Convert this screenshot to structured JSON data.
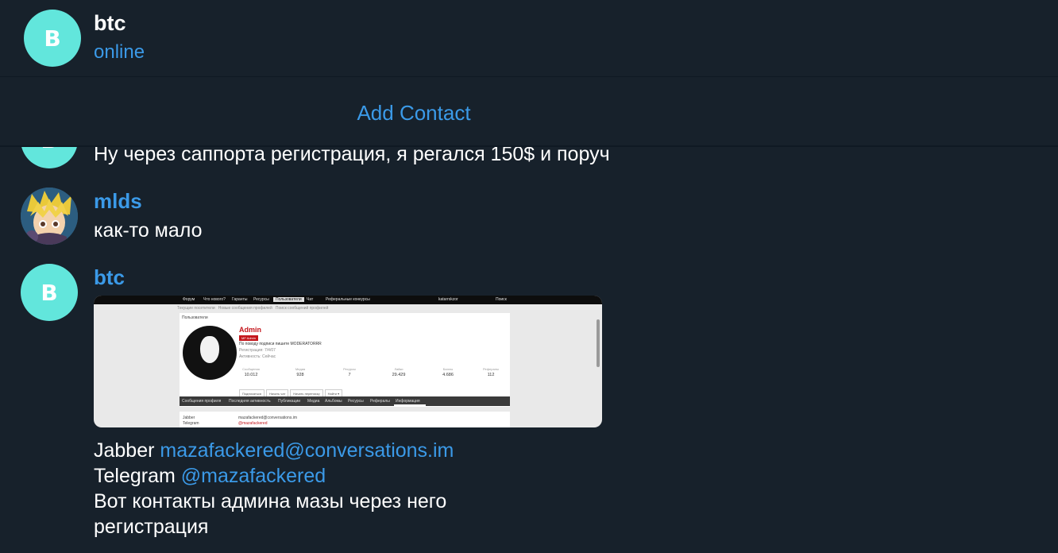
{
  "header": {
    "avatar_letter": "B",
    "title": "btc",
    "status": "online"
  },
  "contact_bar": {
    "add_contact_label": "Add Contact"
  },
  "messages": [
    {
      "text": "Ну через саппорта регистрация, я регался 150$ и поруч"
    },
    {
      "sender": "mlds",
      "text": "как-то мало"
    },
    {
      "sender": "btc",
      "avatar_letter": "B",
      "jabber_label": "Jabber",
      "jabber_link": "mazafackered@conversations.im",
      "telegram_label": "Telegram",
      "telegram_link": "@mazafackered",
      "line3": "Вот контакты админа мазы через него",
      "line4": "регистрация"
    }
  ],
  "screenshot_image": {
    "nav": [
      "Форум",
      "Что нового?",
      "Гаранты",
      "Ресурсы",
      "Пользователи",
      "Чат",
      "Реферальные конкурсы"
    ],
    "nav_user": "katarrskzor",
    "nav_search": "Поиск",
    "subnav": [
      "Текущие посетители",
      "Новые сообщения профилей",
      "Поиск сообщений профилей"
    ],
    "breadcrumb": "Пользователи",
    "name": "Admin",
    "role": "MF Admin",
    "note": "По поводу подписи пишите MODERATORRR",
    "registered": "Регистрация: 7/4/07",
    "activity": "Активность: Сейчас",
    "stats": [
      {
        "k": "Сообщения",
        "v": "10.012"
      },
      {
        "k": "Медиа",
        "v": "928"
      },
      {
        "k": "Ресурсы",
        "v": "7"
      },
      {
        "k": "Лайки",
        "v": "29.429"
      },
      {
        "k": "Баллы",
        "v": "4.686"
      },
      {
        "k": "Рефералы",
        "v": "112"
      }
    ],
    "buttons": [
      "Подписаться",
      "Начать чат",
      "Начать переписку",
      "Найти ▾"
    ],
    "tabs": [
      "Сообщения профиля",
      "Последняя активность",
      "Публикации",
      "Медиа",
      "Альбомы",
      "Ресурсы",
      "Рефералы",
      "Информация"
    ],
    "info_rows": [
      {
        "k": "Jabber",
        "v": "mazafackered@conversations.im"
      },
      {
        "k": "Telegram",
        "v": "@mazafackered"
      }
    ]
  }
}
